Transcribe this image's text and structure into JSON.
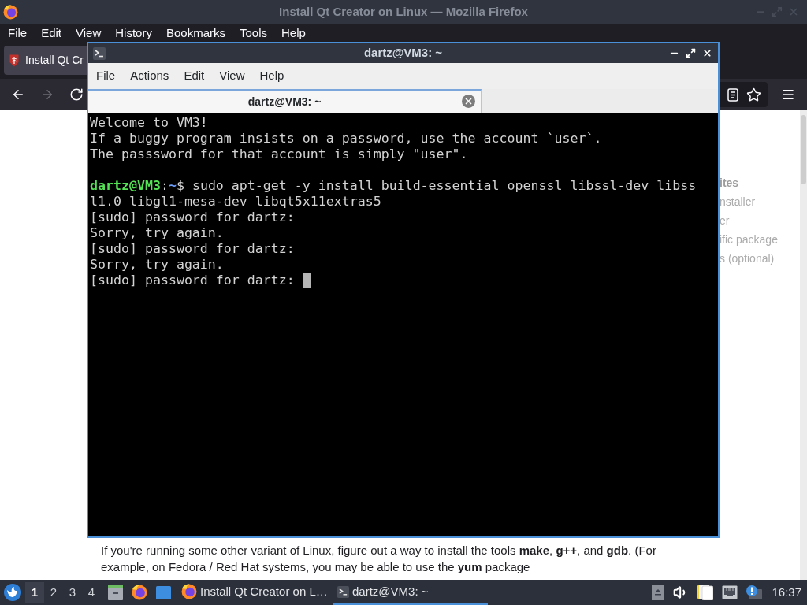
{
  "browser": {
    "title": "Install Qt Creator on Linux — Mozilla Firefox",
    "menu": [
      "File",
      "Edit",
      "View",
      "History",
      "Bookmarks",
      "Tools",
      "Help"
    ],
    "tabs": [
      {
        "label": "Install Qt Cr",
        "selected": true
      }
    ],
    "nav": [
      {
        "kind": "back",
        "disabled": false
      },
      {
        "kind": "forward",
        "disabled": true
      },
      {
        "kind": "reload",
        "disabled": false
      }
    ],
    "toc": [
      {
        "kind": "heading",
        "label": "ites"
      },
      {
        "kind": "link",
        "label": "nstaller"
      },
      {
        "kind": "link",
        "label": "er"
      },
      {
        "kind": "link",
        "label": "ific package"
      },
      {
        "kind": "link",
        "label": "s (optional)"
      }
    ],
    "paragraph": "If you're running some other variant of Linux, figure out a way to install the tools **make**, **g++**, and **gdb**. (For example, on Fedora / Red Hat systems, you may be able to use the **yum** package"
  },
  "terminal": {
    "title": "dartz@VM3: ~",
    "menu": [
      "File",
      "Actions",
      "Edit",
      "View",
      "Help"
    ],
    "tabs": [
      {
        "label": "dartz@VM3: ~",
        "selected": true
      }
    ],
    "lines": [
      {
        "kind": "output",
        "text": "Welcome to VM3!"
      },
      {
        "kind": "output",
        "text": "If a buggy program insists on a password, use the account `user`."
      },
      {
        "kind": "output",
        "text": "The passsword for that account is simply \"user\"."
      },
      {
        "kind": "blank"
      },
      {
        "kind": "prompt",
        "parts": [
          {
            "kind": "user",
            "text": "dartz@VM3"
          },
          {
            "kind": "plain",
            "text": ":"
          },
          {
            "kind": "path",
            "text": "~"
          },
          {
            "kind": "plain",
            "text": "$ sudo apt-get -y install build-essential openssl libssl-dev libss"
          }
        ]
      },
      {
        "kind": "output",
        "text": "l1.0 libgl1-mesa-dev libqt5x11extras5"
      },
      {
        "kind": "output",
        "text": "[sudo] password for dartz:"
      },
      {
        "kind": "output",
        "text": "Sorry, try again."
      },
      {
        "kind": "output",
        "text": "[sudo] password for dartz:"
      },
      {
        "kind": "output",
        "text": "Sorry, try again."
      },
      {
        "kind": "output",
        "text": "[sudo] password for dartz:"
      }
    ],
    "cursor": true
  },
  "taskbar": {
    "workspaces": [
      {
        "label": "1",
        "selected": true
      },
      {
        "label": "2",
        "selected": false
      },
      {
        "label": "3",
        "selected": false
      },
      {
        "label": "4",
        "selected": false
      }
    ],
    "tasks": [
      {
        "kind": "browser",
        "label": "Install Qt Creator on L…",
        "selected": false
      },
      {
        "kind": "terminal",
        "label": "dartz@VM3: ~",
        "selected": true
      }
    ],
    "clock": "16:37"
  }
}
